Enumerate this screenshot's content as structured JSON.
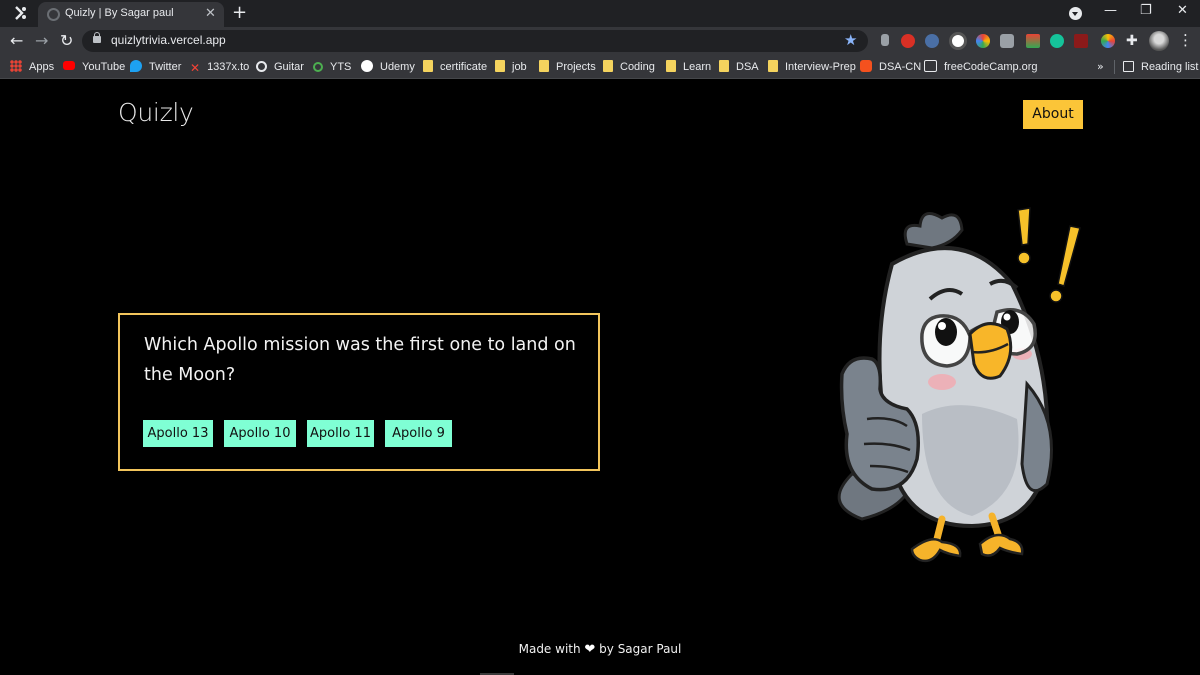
{
  "browser": {
    "tab_title": "Quizly | By Sagar paul",
    "url": "quizlytrivia.vercel.app",
    "bookmarks": [
      {
        "label": "Apps",
        "icon": "apps-grid-icon"
      },
      {
        "label": "YouTube",
        "icon": "youtube-icon"
      },
      {
        "label": "Twitter",
        "icon": "twitter-icon"
      },
      {
        "label": "1337x.to",
        "icon": "1337x-icon"
      },
      {
        "label": "Guitar",
        "icon": "guitar-icon"
      },
      {
        "label": "YTS",
        "icon": "yts-icon"
      },
      {
        "label": "Udemy",
        "icon": "udemy-icon"
      },
      {
        "label": "certificate",
        "icon": "folder-icon"
      },
      {
        "label": "job",
        "icon": "folder-icon"
      },
      {
        "label": "Projects",
        "icon": "folder-icon"
      },
      {
        "label": "Coding",
        "icon": "folder-icon"
      },
      {
        "label": "Learn",
        "icon": "folder-icon"
      },
      {
        "label": "DSA",
        "icon": "folder-icon"
      },
      {
        "label": "Interview-Prep",
        "icon": "folder-icon"
      },
      {
        "label": "DSA-CN",
        "icon": "coding-ninjas-icon"
      },
      {
        "label": "freeCodeCamp.org",
        "icon": "freecodecamp-icon"
      }
    ],
    "more_bookmarks": "»",
    "reading_list": "Reading list"
  },
  "header": {
    "brand": "Quizly",
    "about_label": "About"
  },
  "quiz": {
    "question": "Which Apollo mission was the first one to land on the Moon?",
    "answers": [
      "Apollo 13",
      "Apollo 10",
      "Apollo 11",
      "Apollo 9"
    ]
  },
  "footer": {
    "made_with": "Made with",
    "by": "by Sagar Paul"
  },
  "colors": {
    "page_bg": "#000000",
    "accent_yellow": "#fbc538",
    "card_border": "#f2c55c",
    "answer_bg": "#7fffd4"
  }
}
